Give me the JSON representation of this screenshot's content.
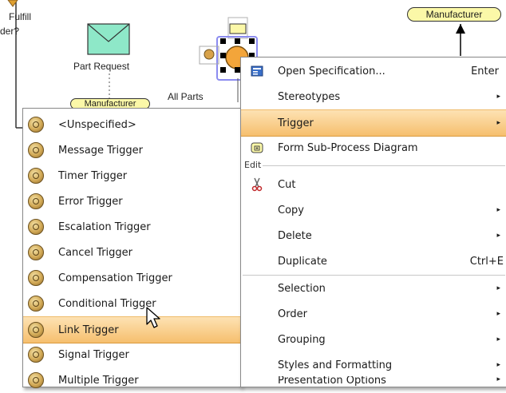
{
  "diagram": {
    "labels": {
      "fulfill": "Fulfill",
      "order": "der?",
      "part_request": "Part Request",
      "all_parts": "All Parts",
      "manufacturer_top": "Manufacturer",
      "manufacturer_small": "Manufacturer"
    },
    "colors": {
      "envelope": "#8ee8c8",
      "badge": "#fbf8a8",
      "event": "#f3a53a"
    }
  },
  "trigger_submenu": {
    "items": [
      {
        "label": "<Unspecified>"
      },
      {
        "label": "Message Trigger"
      },
      {
        "label": "Timer Trigger"
      },
      {
        "label": "Error Trigger"
      },
      {
        "label": "Escalation Trigger"
      },
      {
        "label": "Cancel Trigger"
      },
      {
        "label": "Compensation Trigger"
      },
      {
        "label": "Conditional Trigger"
      },
      {
        "label": "Link Trigger"
      },
      {
        "label": "Signal Trigger"
      },
      {
        "label": "Multiple Trigger"
      }
    ],
    "highlighted": "Link Trigger"
  },
  "context_menu": {
    "items": [
      {
        "label": "Open Specification...",
        "shortcut": "Enter"
      },
      {
        "label": "Stereotypes",
        "submenu": "▸"
      },
      {
        "label": "Trigger",
        "submenu": "▸"
      },
      {
        "label": "Form Sub-Process Diagram"
      },
      {
        "label": "Cut"
      },
      {
        "label": "Copy",
        "submenu": "▸"
      },
      {
        "label": "Delete",
        "submenu": "▸"
      },
      {
        "label": "Duplicate",
        "shortcut": "Ctrl+E"
      },
      {
        "label": "Selection",
        "submenu": "▸"
      },
      {
        "label": "Order",
        "submenu": "▸"
      },
      {
        "label": "Grouping",
        "submenu": "▸"
      },
      {
        "label": "Styles and Formatting",
        "submenu": "▸"
      },
      {
        "label": "Presentation Options",
        "submenu": "▸"
      }
    ],
    "group_edit": "Edit",
    "highlighted": "Trigger"
  }
}
